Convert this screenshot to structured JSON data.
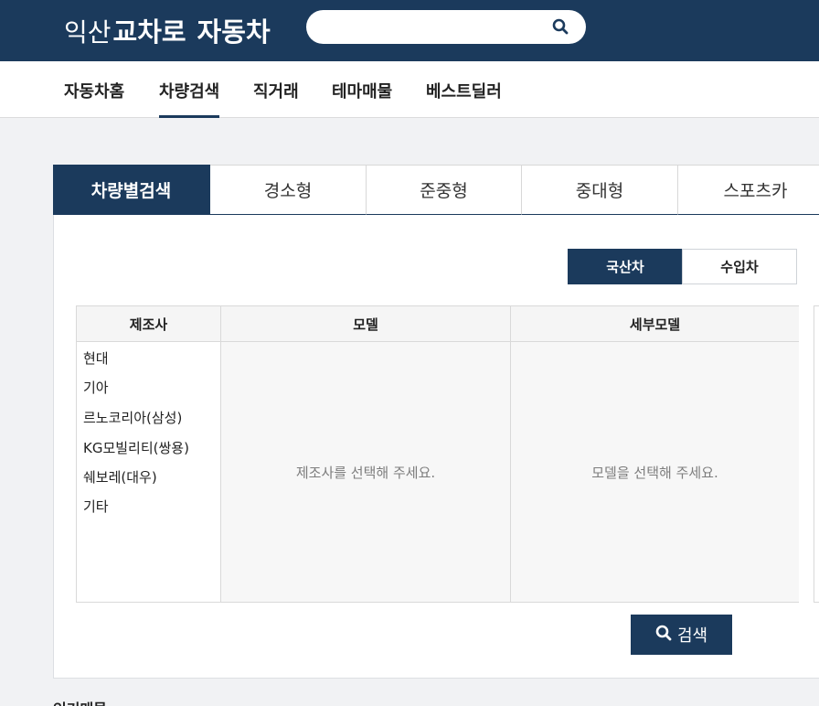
{
  "header": {
    "logo_part1": "익산",
    "logo_part2": "교차로",
    "logo_part3": "자동차",
    "search_placeholder": "",
    "search_icon": "search-icon"
  },
  "nav": {
    "items": [
      "자동차홈",
      "차량검색",
      "직거래",
      "테마매물",
      "베스트딜러"
    ],
    "active": "차량검색"
  },
  "tabs": {
    "items": [
      "차량별검색",
      "경소형",
      "준중형",
      "중대형",
      "스포츠카"
    ],
    "active": "차량별검색"
  },
  "origin_toggle": {
    "domestic": "국산차",
    "imported": "수입차",
    "selected": "국산차"
  },
  "table": {
    "headers": [
      "제조사",
      "모델",
      "세부모델"
    ],
    "makers": [
      "현대",
      "기아",
      "르노코리아(삼성)",
      "KG모빌리티(쌍용)",
      "쉐보레(대우)",
      "기타"
    ],
    "model_placeholder": "제조사를 선택해 주세요.",
    "submodel_placeholder": "모델을 선택해 주세요."
  },
  "search_button": {
    "label": "검색",
    "icon": "search-icon"
  },
  "bottom": {
    "partial_text": "인기매물"
  },
  "colors": {
    "brand": "#1b3a5c",
    "background": "#f1f2f4"
  }
}
